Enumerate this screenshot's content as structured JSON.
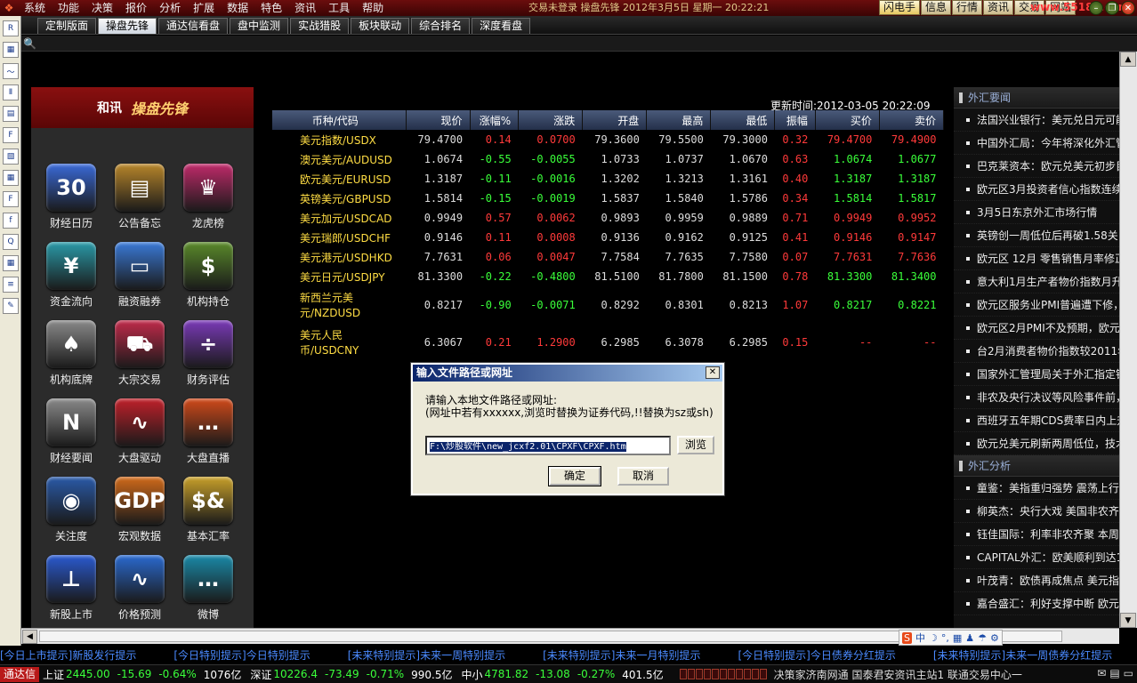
{
  "menubar": {
    "items": [
      "系统",
      "功能",
      "决策",
      "报价",
      "分析",
      "扩展",
      "数据",
      "特色",
      "资讯",
      "工具",
      "帮助"
    ],
    "status": "交易未登录 操盘先锋 2012年3月5日 星期一 20:22:21",
    "right_buttons": [
      "闪电手",
      "信息",
      "行情",
      "资讯",
      "交易",
      "网站"
    ],
    "watermark": "www.55188.com"
  },
  "tabs": [
    "定制版面",
    "操盘先锋",
    "通达信看盘",
    "盘中监测",
    "实战猎股",
    "板块联动",
    "综合排名",
    "深度看盘"
  ],
  "active_tab": "操盘先锋",
  "left_toolbar": [
    "R",
    "▦",
    "〜",
    "Ⅱ",
    "▤",
    "F",
    "▧",
    "▦",
    "F",
    "f",
    "Q",
    "▦",
    "≡",
    "✎"
  ],
  "brand": {
    "left": "和讯",
    "right": "操盘先锋"
  },
  "apps": [
    {
      "label": "财经日历",
      "glyph": "30",
      "color": "#3a6ad8"
    },
    {
      "label": "公告备忘",
      "glyph": "▤",
      "color": "#b8862a"
    },
    {
      "label": "龙虎榜",
      "glyph": "♛",
      "color": "#c02a6a"
    },
    {
      "label": "资金流向",
      "glyph": "¥",
      "color": "#2a9aa8"
    },
    {
      "label": "融资融券",
      "glyph": "▭",
      "color": "#3a7ad8"
    },
    {
      "label": "机构持仓",
      "glyph": "$",
      "color": "#5a8a2a"
    },
    {
      "label": "机构底牌",
      "glyph": "♠",
      "color": "#8a8a8a"
    },
    {
      "label": "大宗交易",
      "glyph": "⛟",
      "color": "#c02a4a"
    },
    {
      "label": "财务评估",
      "glyph": "÷",
      "color": "#7a3ab8"
    },
    {
      "label": "财经要闻",
      "glyph": "N",
      "color": "#8a8a8a"
    },
    {
      "label": "大盘驱动",
      "glyph": "∿",
      "color": "#c0202a"
    },
    {
      "label": "大盘直播",
      "glyph": "…",
      "color": "#d04a1a"
    },
    {
      "label": "关注度",
      "glyph": "◉",
      "color": "#2a5aa8"
    },
    {
      "label": "宏观数据",
      "glyph": "GDP",
      "color": "#d06a1a"
    },
    {
      "label": "基本汇率",
      "glyph": "$&",
      "color": "#c8a02a"
    },
    {
      "label": "新股上市",
      "glyph": "⊥",
      "color": "#2a5ad0"
    },
    {
      "label": "价格预测",
      "glyph": "∿",
      "color": "#2a6ad0"
    },
    {
      "label": "微博",
      "glyph": "…",
      "color": "#1a8aa8"
    }
  ],
  "fx": {
    "update_label": "更新时间:2012-03-05 20:22:09",
    "headers": [
      "币种/代码",
      "现价",
      "涨幅%",
      "涨跌",
      "开盘",
      "最高",
      "最低",
      "振幅",
      "买价",
      "卖价"
    ],
    "rows": [
      {
        "name": "美元指数/USDX",
        "price": "79.4700",
        "pct": "0.14",
        "chg": "0.0700",
        "open": "79.3600",
        "high": "79.5500",
        "low": "79.3000",
        "amp": "0.32",
        "bid": "79.4700",
        "ask": "79.4900",
        "dir": "up"
      },
      {
        "name": "澳元美元/AUDUSD",
        "price": "1.0674",
        "pct": "-0.55",
        "chg": "-0.0055",
        "open": "1.0733",
        "high": "1.0737",
        "low": "1.0670",
        "amp": "0.63",
        "bid": "1.0674",
        "ask": "1.0677",
        "dir": "dn"
      },
      {
        "name": "欧元美元/EURUSD",
        "price": "1.3187",
        "pct": "-0.11",
        "chg": "-0.0016",
        "open": "1.3202",
        "high": "1.3213",
        "low": "1.3161",
        "amp": "0.40",
        "bid": "1.3187",
        "ask": "1.3187",
        "dir": "dn"
      },
      {
        "name": "英镑美元/GBPUSD",
        "price": "1.5814",
        "pct": "-0.15",
        "chg": "-0.0019",
        "open": "1.5837",
        "high": "1.5840",
        "low": "1.5786",
        "amp": "0.34",
        "bid": "1.5814",
        "ask": "1.5817",
        "dir": "dn"
      },
      {
        "name": "美元加元/USDCAD",
        "price": "0.9949",
        "pct": "0.57",
        "chg": "0.0062",
        "open": "0.9893",
        "high": "0.9959",
        "low": "0.9889",
        "amp": "0.71",
        "bid": "0.9949",
        "ask": "0.9952",
        "dir": "up"
      },
      {
        "name": "美元瑞郎/USDCHF",
        "price": "0.9146",
        "pct": "0.11",
        "chg": "0.0008",
        "open": "0.9136",
        "high": "0.9162",
        "low": "0.9125",
        "amp": "0.41",
        "bid": "0.9146",
        "ask": "0.9147",
        "dir": "up"
      },
      {
        "name": "美元港元/USDHKD",
        "price": "7.7631",
        "pct": "0.06",
        "chg": "0.0047",
        "open": "7.7584",
        "high": "7.7635",
        "low": "7.7580",
        "amp": "0.07",
        "bid": "7.7631",
        "ask": "7.7636",
        "dir": "up"
      },
      {
        "name": "美元日元/USDJPY",
        "price": "81.3300",
        "pct": "-0.22",
        "chg": "-0.4800",
        "open": "81.5100",
        "high": "81.7800",
        "low": "81.1500",
        "amp": "0.78",
        "bid": "81.3300",
        "ask": "81.3400",
        "dir": "dn"
      },
      {
        "name": "新西兰元美元/NZDUSD",
        "price": "0.8217",
        "pct": "-0.90",
        "chg": "-0.0071",
        "open": "0.8292",
        "high": "0.8301",
        "low": "0.8213",
        "amp": "1.07",
        "bid": "0.8217",
        "ask": "0.8221",
        "dir": "dn",
        "tall": true
      },
      {
        "name": "美元人民币/USDCNY",
        "price": "6.3067",
        "pct": "0.21",
        "chg": "1.2900",
        "open": "6.2985",
        "high": "6.3078",
        "low": "6.2985",
        "amp": "0.15",
        "bid": "--",
        "ask": "--",
        "dir": "up",
        "tall": true
      }
    ]
  },
  "news": {
    "section1": "外汇要闻",
    "items1": [
      "法国兴业银行：美元兑日元可能",
      "中国外汇局：今年将深化外汇管",
      "巴克莱资本：欧元兑美元初步目",
      "欧元区3月投资者信心指数连续",
      "3月5日东京外汇市场行情",
      "英镑创一周低位后再破1.58关口",
      "欧元区 12月 零售销售月率修正",
      "意大利1月生产者物价指数月升",
      "欧元区服务业PMI普遍遭下修，",
      "欧元区2月PMI不及预期，欧元/",
      "台2月消费者物价指数较2011年",
      "国家外汇管理局关于外汇指定银",
      "非农及央行决议等风险事件前，",
      "西班牙五年期CDS费率日内上升",
      "欧元兑美元刷新两周低位，技术"
    ],
    "section2": "外汇分析",
    "items2": [
      "童鉴：美指重归强势 震荡上行",
      "柳英杰：央行大戏 美国非农齐",
      "钰佳国际：利率非农齐聚 本周",
      "CAPITAL外汇：欧美顺利到达1.",
      "叶茂青：欧债再成焦点 美元指",
      "嘉合盛汇：利好支撑中断 欧元"
    ]
  },
  "ime": [
    "S",
    "中",
    "☽",
    "°,",
    "▦",
    "♟",
    "☂",
    "⚙"
  ],
  "ticker": [
    "[今日上市提示]新股发行提示",
    "[今日特别提示]今日特别提示",
    "[未来特别提示]未来一周特别提示",
    "[未来特别提示]未来一月特别提示",
    "[今日特别提示]今日债券分红提示",
    "[未来特别提示]未来一周债券分红提示"
  ],
  "statusbar": {
    "logo": "通达信",
    "sh_label": "上证",
    "sh_val": "2445.00",
    "sh_chg": "-15.69",
    "sh_pct": "-0.64%",
    "sh_amt": "1076亿",
    "sz_label": "深证",
    "sz_val": "10226.4",
    "sz_chg": "-73.49",
    "sz_pct": "-0.71%",
    "sz_amt": "990.5亿",
    "zx_label": "中小",
    "zx_val": "4781.82",
    "zx_chg": "-13.08",
    "zx_pct": "-0.27%",
    "zx_amt": "401.5亿",
    "servers": "决策家济南网通 国泰君安资讯主站1 联通交易中心一"
  },
  "dialog": {
    "title": "输入文件路径或网址",
    "line1": "请输入本地文件路径或网址:",
    "line2": "(网址中若有xxxxxx,浏览时替换为证券代码,!!替换为sz或sh)",
    "path": "F:\\炒股软件\\new_jcxf2.01\\CPXF\\CPXF.htm",
    "browse": "浏览",
    "ok": "确定",
    "cancel": "取消"
  }
}
